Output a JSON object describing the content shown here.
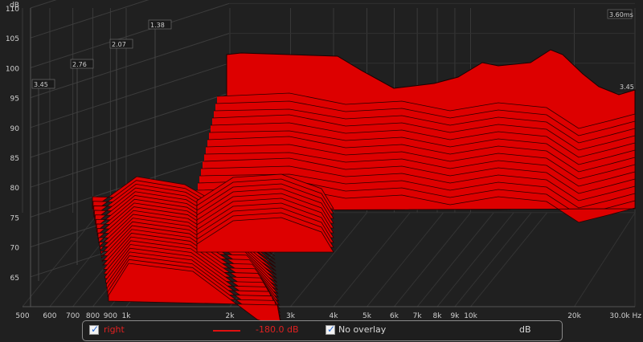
{
  "chart_data": {
    "type": "area",
    "subtype": "waterfall-3d",
    "ylabel": "dB",
    "ylim": [
      60,
      110
    ],
    "y_ticks": [
      65,
      70,
      75,
      80,
      85,
      90,
      95,
      100,
      105,
      110
    ],
    "x_ticks": [
      "500",
      "600",
      "700",
      "800",
      "900",
      "1k",
      "2k",
      "3k",
      "4k",
      "5k",
      "6k",
      "7k",
      "8k",
      "9k",
      "10k",
      "20k",
      "30.0k Hz"
    ],
    "x_tick_values": [
      500,
      600,
      700,
      800,
      900,
      1000,
      2000,
      3000,
      4000,
      5000,
      6000,
      7000,
      8000,
      9000,
      10000,
      20000,
      30000
    ],
    "xlim": [
      500,
      30000
    ],
    "xscale": "log",
    "time_unit": "ms",
    "time_labels": [
      "3.45",
      "2.76",
      "2.07",
      "1.38"
    ],
    "back_time_label": "3.60ms",
    "right_time_label": "3.45",
    "series_color": "#dd0000",
    "grid": true
  },
  "legend": {
    "series_name": "right",
    "series_checked": true,
    "level": "-180.0 dB",
    "overlay_label": "No overlay",
    "overlay_checked": true,
    "unit": "dB",
    "check_glyph": "✓"
  }
}
